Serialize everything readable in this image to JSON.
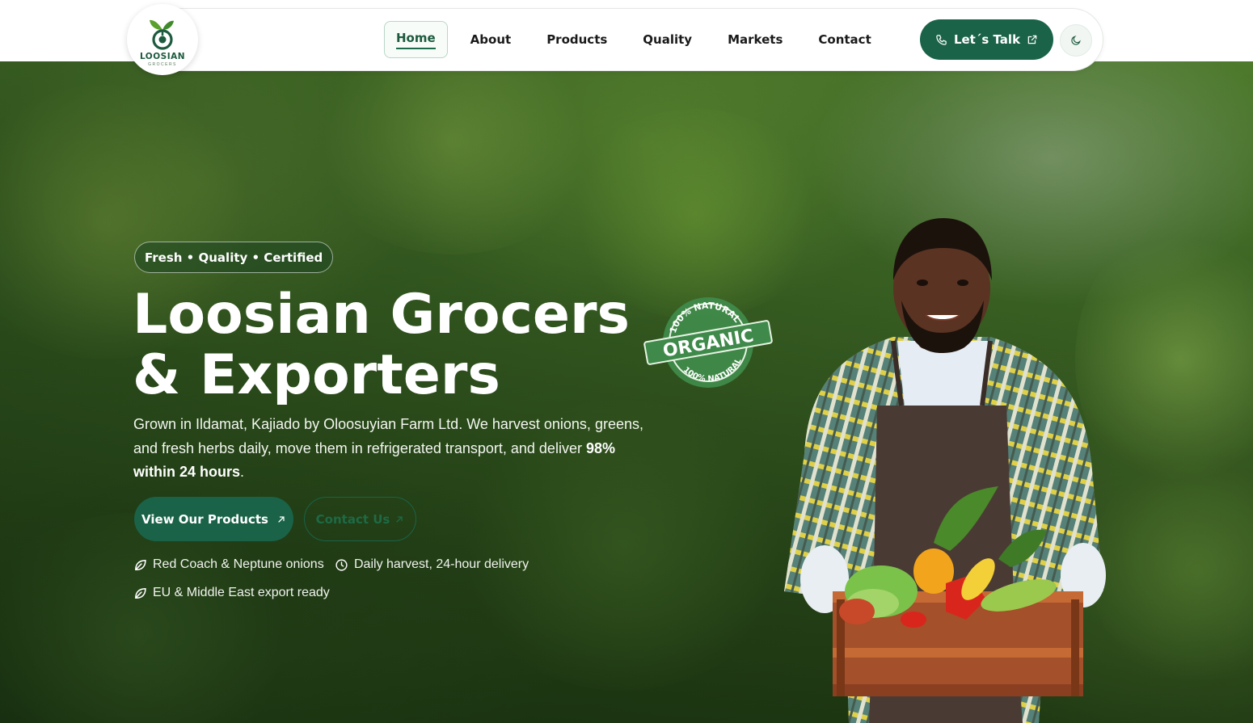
{
  "brand": {
    "name": "LOOSIAN",
    "tagline": "GROCERS",
    "accent": "#1a6349"
  },
  "nav": {
    "items": [
      {
        "label": "Home",
        "active": true
      },
      {
        "label": "About",
        "active": false
      },
      {
        "label": "Products",
        "active": false
      },
      {
        "label": "Quality",
        "active": false
      },
      {
        "label": "Markets",
        "active": false
      },
      {
        "label": "Contact",
        "active": false
      }
    ],
    "cta_label": "Let´s Talk",
    "cta_icon": "phone-icon",
    "cta_trailing_icon": "external-link-icon",
    "theme_toggle_icon": "moon-icon"
  },
  "hero": {
    "badge": "Fresh • Quality • Certified",
    "title_line1": "Loosian Grocers",
    "title_line2": "& Exporters",
    "description_text": "Grown in Ildamat, Kajiado by Oloosuyian Farm Ltd. We harvest onions, greens, and fresh herbs daily, move them in refrigerated transport, and deliver ",
    "description_highlight": "98% within 24 hours",
    "description_end": ".",
    "primary_button": "View Our Products",
    "secondary_button": "Contact Us",
    "features": [
      {
        "icon": "leaf-icon",
        "text": "Red Coach & Neptune onions"
      },
      {
        "icon": "clock-icon",
        "text": "Daily harvest, 24-hour delivery"
      },
      {
        "icon": "leaf-icon",
        "text": "EU & Middle East export ready"
      }
    ],
    "stamp": {
      "top": "100% NATURAL",
      "center": "ORGANIC",
      "bottom": "100% NATURAL"
    }
  }
}
